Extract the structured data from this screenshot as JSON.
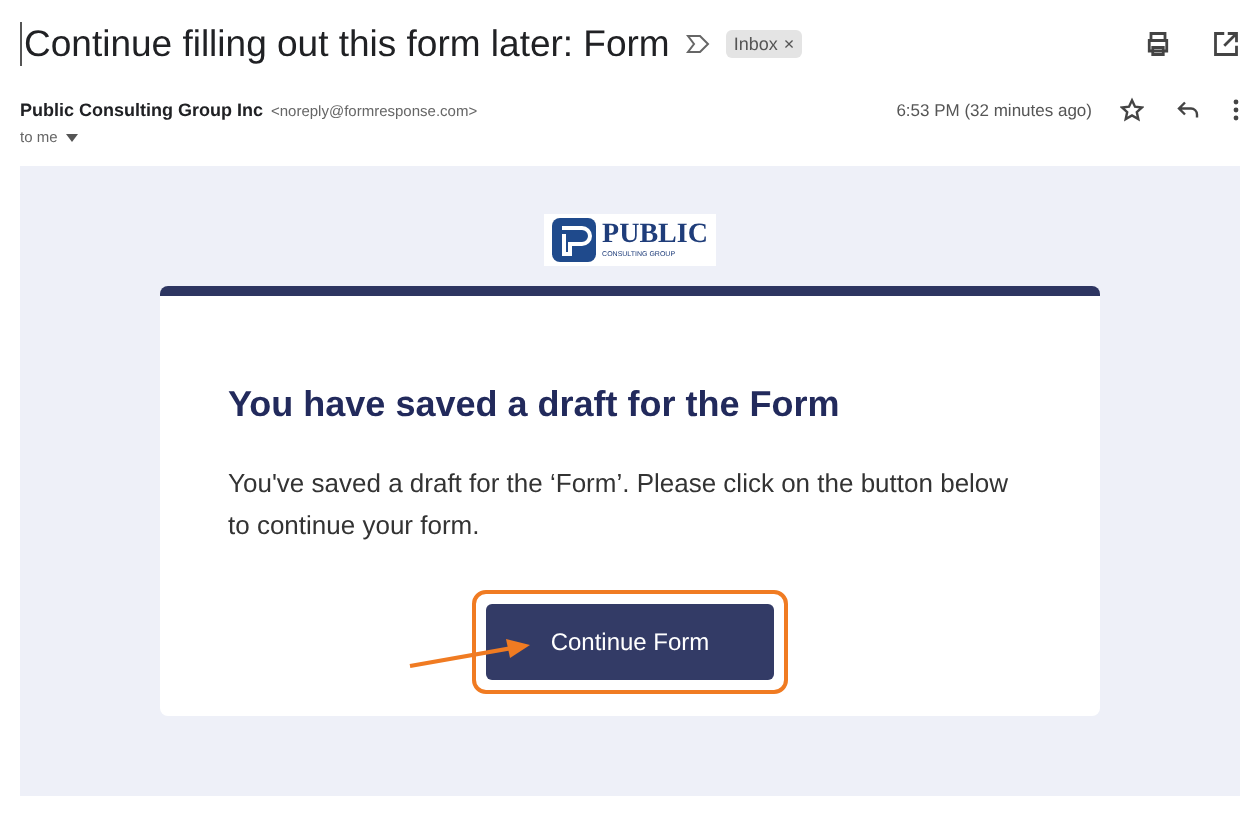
{
  "subject": "Continue filling out this form later: Form",
  "label": {
    "text": "Inbox",
    "close": "×"
  },
  "sender": {
    "name": "Public Consulting Group Inc",
    "email": "<noreply@formresponse.com>",
    "recipient": "to me",
    "time": "6:53 PM (32 minutes ago)"
  },
  "logo": {
    "name": "PUBLIC",
    "tagline": "CONSULTING GROUP"
  },
  "card": {
    "heading": "You have saved a draft for the Form",
    "body": "You've saved a draft for the ‘Form’. Please click on the button below to continue your form.",
    "button": "Continue Form",
    "highlighted": true
  }
}
